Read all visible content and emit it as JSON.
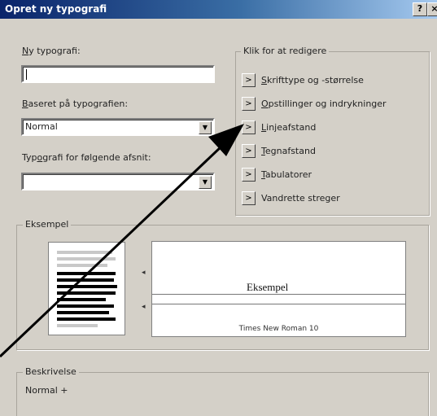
{
  "window": {
    "title": "Opret ny typografi",
    "help_label": "?",
    "close_label": "×"
  },
  "new_style": {
    "label_hotkey": "N",
    "label_rest": "y typografi:",
    "value": ""
  },
  "based_on": {
    "label_hotkey": "B",
    "label_rest": "aseret på typografien:",
    "value": "Normal"
  },
  "next_style": {
    "label_before": "Typ",
    "label_hotkey": "o",
    "label_rest": "grafi for følgende afsnit:",
    "value": ""
  },
  "edit_group": {
    "title": "Klik for at redigere",
    "button_label": ">",
    "items": [
      {
        "hotkey": "S",
        "rest": "krifttype og -størrelse"
      },
      {
        "hotkey": "O",
        "rest": "pstillinger og indrykninger"
      },
      {
        "hotkey": "L",
        "rest": "injeafstand"
      },
      {
        "hotkey": "T",
        "rest": "egnafstand"
      },
      {
        "hotkey": "T",
        "rest": "abulatorer"
      },
      {
        "hotkey": "",
        "rest": "Vandrette streger"
      }
    ]
  },
  "example": {
    "title": "Eksempel",
    "preview_text": "Eksempel",
    "font_info": "Times New Roman 10"
  },
  "description": {
    "title": "Beskrivelse",
    "text": "Normal +"
  },
  "colors": {
    "dialog_bg": "#d4d0c8",
    "annotation_arrow": "#000000"
  }
}
